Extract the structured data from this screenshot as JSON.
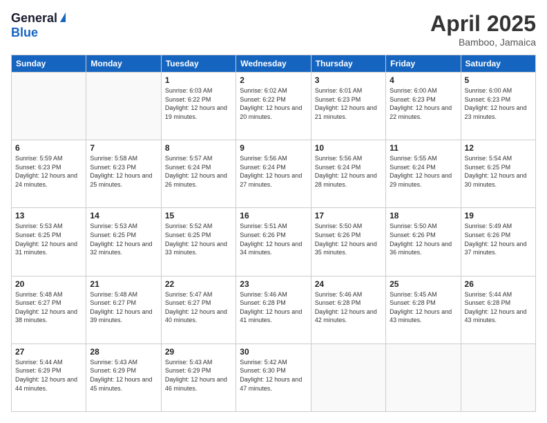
{
  "logo": {
    "general": "General",
    "blue": "Blue"
  },
  "title": "April 2025",
  "location": "Bamboo, Jamaica",
  "days_of_week": [
    "Sunday",
    "Monday",
    "Tuesday",
    "Wednesday",
    "Thursday",
    "Friday",
    "Saturday"
  ],
  "weeks": [
    [
      {
        "day": "",
        "info": ""
      },
      {
        "day": "",
        "info": ""
      },
      {
        "day": "1",
        "info": "Sunrise: 6:03 AM\nSunset: 6:22 PM\nDaylight: 12 hours and 19 minutes."
      },
      {
        "day": "2",
        "info": "Sunrise: 6:02 AM\nSunset: 6:22 PM\nDaylight: 12 hours and 20 minutes."
      },
      {
        "day": "3",
        "info": "Sunrise: 6:01 AM\nSunset: 6:23 PM\nDaylight: 12 hours and 21 minutes."
      },
      {
        "day": "4",
        "info": "Sunrise: 6:00 AM\nSunset: 6:23 PM\nDaylight: 12 hours and 22 minutes."
      },
      {
        "day": "5",
        "info": "Sunrise: 6:00 AM\nSunset: 6:23 PM\nDaylight: 12 hours and 23 minutes."
      }
    ],
    [
      {
        "day": "6",
        "info": "Sunrise: 5:59 AM\nSunset: 6:23 PM\nDaylight: 12 hours and 24 minutes."
      },
      {
        "day": "7",
        "info": "Sunrise: 5:58 AM\nSunset: 6:23 PM\nDaylight: 12 hours and 25 minutes."
      },
      {
        "day": "8",
        "info": "Sunrise: 5:57 AM\nSunset: 6:24 PM\nDaylight: 12 hours and 26 minutes."
      },
      {
        "day": "9",
        "info": "Sunrise: 5:56 AM\nSunset: 6:24 PM\nDaylight: 12 hours and 27 minutes."
      },
      {
        "day": "10",
        "info": "Sunrise: 5:56 AM\nSunset: 6:24 PM\nDaylight: 12 hours and 28 minutes."
      },
      {
        "day": "11",
        "info": "Sunrise: 5:55 AM\nSunset: 6:24 PM\nDaylight: 12 hours and 29 minutes."
      },
      {
        "day": "12",
        "info": "Sunrise: 5:54 AM\nSunset: 6:25 PM\nDaylight: 12 hours and 30 minutes."
      }
    ],
    [
      {
        "day": "13",
        "info": "Sunrise: 5:53 AM\nSunset: 6:25 PM\nDaylight: 12 hours and 31 minutes."
      },
      {
        "day": "14",
        "info": "Sunrise: 5:53 AM\nSunset: 6:25 PM\nDaylight: 12 hours and 32 minutes."
      },
      {
        "day": "15",
        "info": "Sunrise: 5:52 AM\nSunset: 6:25 PM\nDaylight: 12 hours and 33 minutes."
      },
      {
        "day": "16",
        "info": "Sunrise: 5:51 AM\nSunset: 6:26 PM\nDaylight: 12 hours and 34 minutes."
      },
      {
        "day": "17",
        "info": "Sunrise: 5:50 AM\nSunset: 6:26 PM\nDaylight: 12 hours and 35 minutes."
      },
      {
        "day": "18",
        "info": "Sunrise: 5:50 AM\nSunset: 6:26 PM\nDaylight: 12 hours and 36 minutes."
      },
      {
        "day": "19",
        "info": "Sunrise: 5:49 AM\nSunset: 6:26 PM\nDaylight: 12 hours and 37 minutes."
      }
    ],
    [
      {
        "day": "20",
        "info": "Sunrise: 5:48 AM\nSunset: 6:27 PM\nDaylight: 12 hours and 38 minutes."
      },
      {
        "day": "21",
        "info": "Sunrise: 5:48 AM\nSunset: 6:27 PM\nDaylight: 12 hours and 39 minutes."
      },
      {
        "day": "22",
        "info": "Sunrise: 5:47 AM\nSunset: 6:27 PM\nDaylight: 12 hours and 40 minutes."
      },
      {
        "day": "23",
        "info": "Sunrise: 5:46 AM\nSunset: 6:28 PM\nDaylight: 12 hours and 41 minutes."
      },
      {
        "day": "24",
        "info": "Sunrise: 5:46 AM\nSunset: 6:28 PM\nDaylight: 12 hours and 42 minutes."
      },
      {
        "day": "25",
        "info": "Sunrise: 5:45 AM\nSunset: 6:28 PM\nDaylight: 12 hours and 43 minutes."
      },
      {
        "day": "26",
        "info": "Sunrise: 5:44 AM\nSunset: 6:28 PM\nDaylight: 12 hours and 43 minutes."
      }
    ],
    [
      {
        "day": "27",
        "info": "Sunrise: 5:44 AM\nSunset: 6:29 PM\nDaylight: 12 hours and 44 minutes."
      },
      {
        "day": "28",
        "info": "Sunrise: 5:43 AM\nSunset: 6:29 PM\nDaylight: 12 hours and 45 minutes."
      },
      {
        "day": "29",
        "info": "Sunrise: 5:43 AM\nSunset: 6:29 PM\nDaylight: 12 hours and 46 minutes."
      },
      {
        "day": "30",
        "info": "Sunrise: 5:42 AM\nSunset: 6:30 PM\nDaylight: 12 hours and 47 minutes."
      },
      {
        "day": "",
        "info": ""
      },
      {
        "day": "",
        "info": ""
      },
      {
        "day": "",
        "info": ""
      }
    ]
  ]
}
